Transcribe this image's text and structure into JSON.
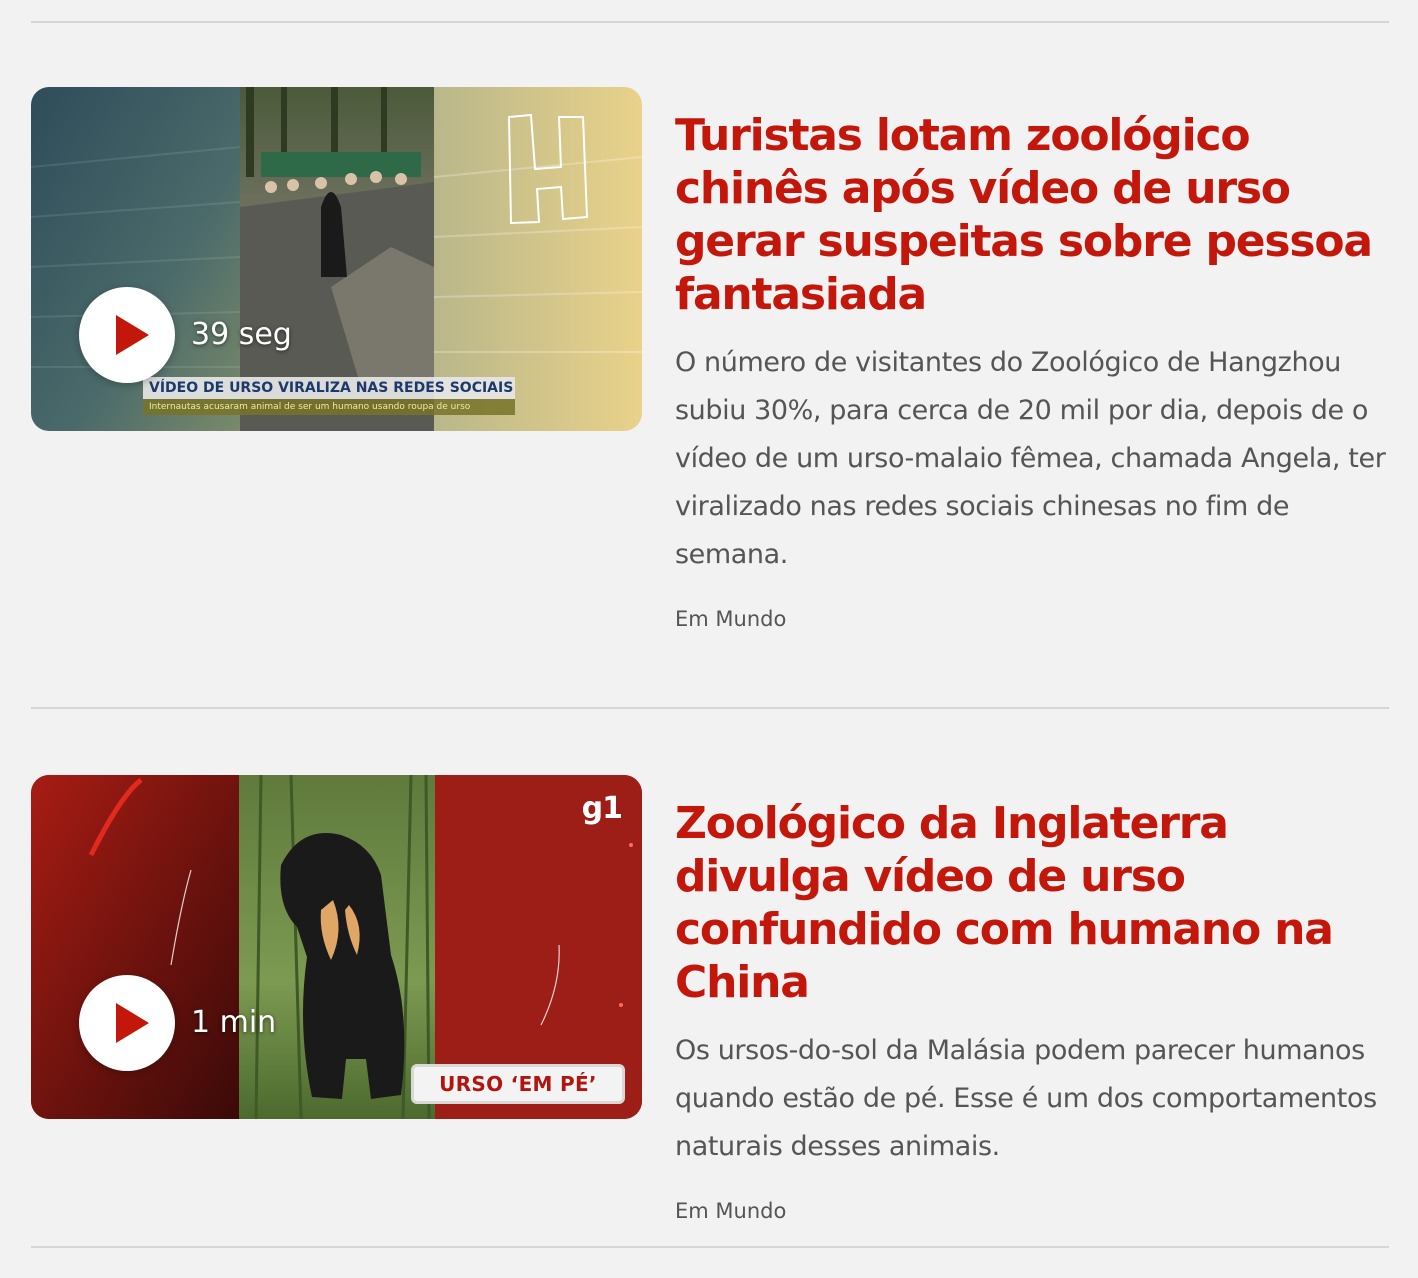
{
  "articles": [
    {
      "duration": "39 seg",
      "title": "Turistas lotam zoológico chinês após vídeo de urso gerar suspeitas sobre pessoa fantasiada",
      "summary": "O número de visitantes do Zoológico de Hangzhou subiu 30%, para cerca de 20 mil por dia, depois de o vídeo de um urso-malaio fêmea, chamada Angela, ter viralizado nas redes sociais chinesas no fim de semana.",
      "section": "Em Mundo",
      "thumbnail": {
        "overlay_title": "VÍDEO DE URSO VIRALIZA NAS REDES SOCIAIS",
        "overlay_subtitle": "Internautas acusaram animal de ser um humano usando roupa de urso",
        "logo_letter": "H"
      }
    },
    {
      "duration": "1 min",
      "title": "Zoológico da Inglaterra divulga vídeo de urso confundido com humano na China",
      "summary": "Os ursos-do-sol da Malásia podem parecer humanos quando estão de pé. Esse é um dos comportamentos naturais desses animais.",
      "section": "Em Mundo",
      "thumbnail": {
        "logo": "g1",
        "tag": "URSO ‘EM PÉ’"
      }
    }
  ],
  "colors": {
    "background": "#f2f2f2",
    "title": "#c4170c",
    "text": "#555555",
    "divider": "#d6d6d6"
  },
  "icons": [
    "play-icon"
  ]
}
